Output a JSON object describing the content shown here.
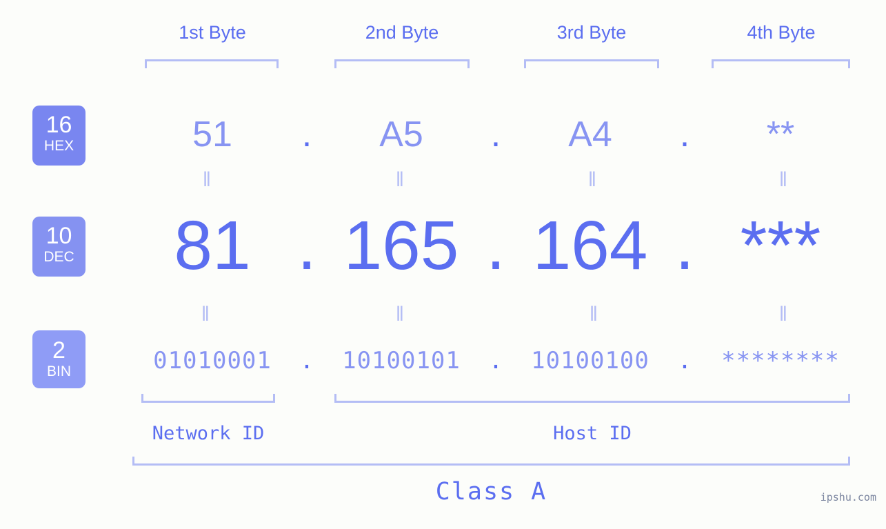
{
  "watermark": "ipshu.com",
  "byte_headers": [
    {
      "label": "1st Byte"
    },
    {
      "label": "2nd Byte"
    },
    {
      "label": "3rd Byte"
    },
    {
      "label": "4th Byte"
    }
  ],
  "bases": [
    {
      "number": "16",
      "abbr": "HEX"
    },
    {
      "number": "10",
      "abbr": "DEC"
    },
    {
      "number": "2",
      "abbr": "BIN"
    }
  ],
  "rows": {
    "hex": {
      "base_number": "16",
      "base_abbr": "HEX",
      "values": [
        "51",
        "A5",
        "A4",
        "**"
      ],
      "separator": "."
    },
    "dec": {
      "base_number": "10",
      "base_abbr": "DEC",
      "values": [
        "81",
        "165",
        "164",
        "***"
      ],
      "separator": "."
    },
    "bin": {
      "base_number": "2",
      "base_abbr": "BIN",
      "values": [
        "01010001",
        "10100101",
        "10100100",
        "********"
      ],
      "separator": "."
    }
  },
  "equality_glyph": "‖",
  "id_sections": [
    {
      "label": "Network ID"
    },
    {
      "label": "Host ID"
    }
  ],
  "class": {
    "label": "Class A"
  },
  "colors": {
    "background": "#fcfdfa",
    "accent_strong": "#5b6ef0",
    "accent_mid": "#8794f2",
    "accent_light": "#b4bdf5",
    "badge_hex": "#7986f0",
    "badge_dec": "#8592f1",
    "badge_bin": "#8f9cf6",
    "watermark": "#7c86a0"
  }
}
